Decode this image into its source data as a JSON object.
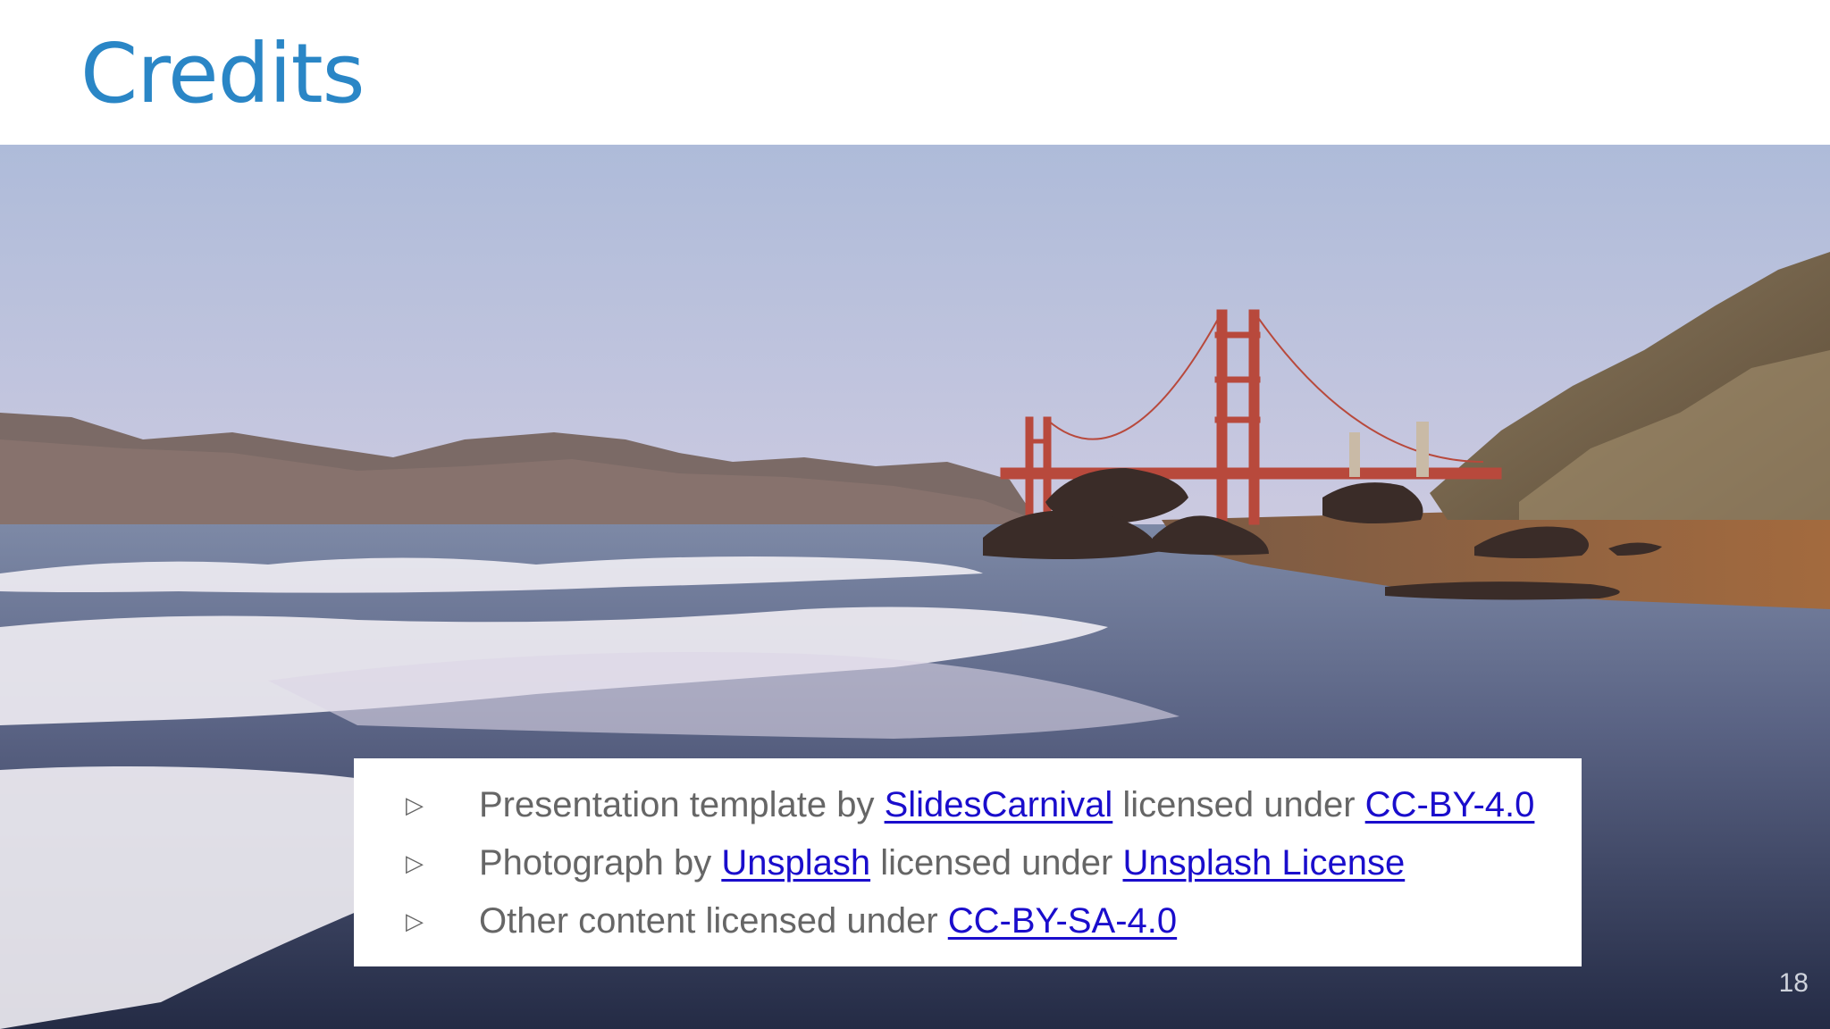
{
  "slide": {
    "title": "Credits",
    "page_number": "18",
    "photo_subject": "Golden Gate Bridge viewed from the beach",
    "title_color": "#2a86c6",
    "link_color": "#1a0dcc",
    "text_color": "#666666"
  },
  "credits": [
    {
      "bullet": "▷",
      "prefix": "Presentation template by ",
      "link1": "SlidesCarnival",
      "middle": " licensed under ",
      "link2": "CC-BY-4.0"
    },
    {
      "bullet": "▷",
      "prefix": "Photograph by ",
      "link1": "Unsplash",
      "middle": " licensed under ",
      "link2": "Unsplash License"
    },
    {
      "bullet": "▷",
      "prefix": "Other content licensed under ",
      "link1": "CC-BY-SA-4.0"
    }
  ]
}
